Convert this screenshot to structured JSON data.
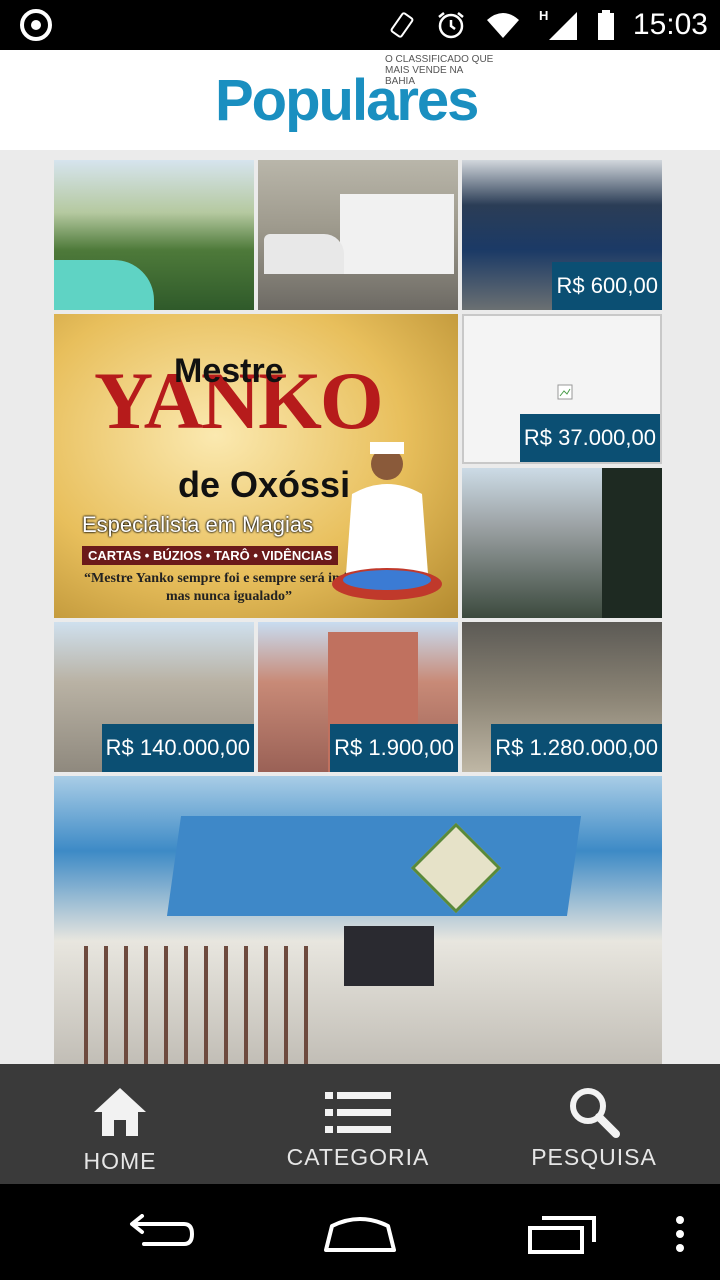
{
  "status_bar": {
    "time": "15:03",
    "icons": [
      "app-logo-icon",
      "rotate-icon",
      "alarm-icon",
      "wifi-icon",
      "signal-icon",
      "battery-icon"
    ]
  },
  "header": {
    "logo": "Populares",
    "tagline": "O CLASSIFICADO QUE MAIS VENDE NA BAHIA"
  },
  "listings": [
    {
      "name": "garden-pool",
      "price": null
    },
    {
      "name": "truck",
      "price": null
    },
    {
      "name": "storefront",
      "price": "R$ 600,00"
    },
    {
      "name": "blank-image",
      "price": "R$ 37.000,00"
    },
    {
      "name": "balcony",
      "price": null
    },
    {
      "name": "building-low",
      "price": "R$ 140.000,00"
    },
    {
      "name": "building-tower",
      "price": "R$ 1.900,00"
    },
    {
      "name": "patio",
      "price": "R$ 1.280.000,00"
    },
    {
      "name": "condo-front",
      "price": null
    }
  ],
  "ad": {
    "mestre": "Mestre",
    "name": "YANKO",
    "sub": "de Oxóssi",
    "specialty": "Especialista em Magias",
    "services": "CARTAS • BÚZIOS • TARÔ • VIDÊNCIAS",
    "quote": "“Mestre Yanko sempre foi e sempre será imitado mas nunca igualado”"
  },
  "bottom_nav": {
    "home": "HOME",
    "categoria": "CATEGORIA",
    "pesquisa": "PESQUISA"
  },
  "colors": {
    "accent": "#0b4f73",
    "logo": "#1a8fc0",
    "nav_bg": "#3a3a3a"
  }
}
